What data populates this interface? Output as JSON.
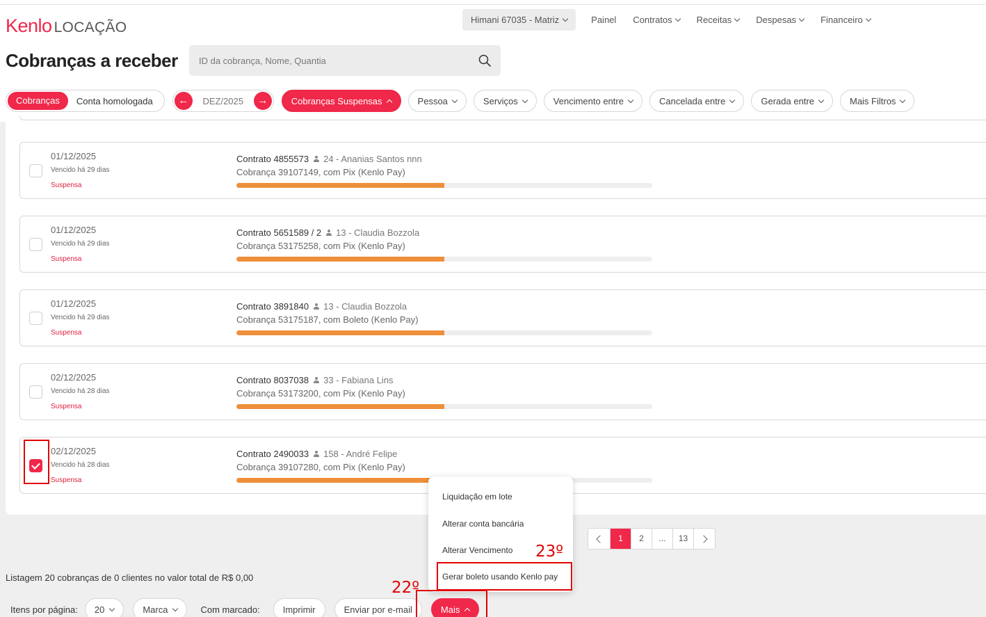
{
  "brand": {
    "name": "Kenlo",
    "product": "LOCAÇÃO"
  },
  "nav": {
    "branch": "Himani 67035 - Matriz",
    "items": [
      "Painel",
      "Contratos",
      "Receitas",
      "Despesas",
      "Financeiro"
    ]
  },
  "page": {
    "title": "Cobranças a receber"
  },
  "search": {
    "placeholder": "ID da cobrança, Nome, Quantia"
  },
  "filters": {
    "tab_active": "Cobranças",
    "tab_other": "Conta homologada",
    "month": "DEZ/2025",
    "suspended": "Cobranças Suspensas",
    "pills": [
      "Pessoa",
      "Serviços",
      "Vencimento entre",
      "Cancelada entre",
      "Gerada entre",
      "Mais Filtros"
    ]
  },
  "charges": [
    {
      "date": "01/12/2025",
      "due": "Vencido há 29 dias",
      "status": "Suspensa",
      "contract": "Contrato 4855573",
      "person": "24 - Ananias Santos nnn",
      "charge": "Cobrança 39107149, com Pix (Kenlo Pay)",
      "progress": 0.5,
      "checked": false
    },
    {
      "date": "01/12/2025",
      "due": "Vencido há 29 dias",
      "status": "Suspensa",
      "contract": "Contrato 5651589 / 2",
      "person": "13 - Claudia Bozzola",
      "charge": "Cobrança 53175258, com Pix (Kenlo Pay)",
      "progress": 0.5,
      "checked": false
    },
    {
      "date": "01/12/2025",
      "due": "Vencido há 29 dias",
      "status": "Suspensa",
      "contract": "Contrato 3891840",
      "person": "13 - Claudia Bozzola",
      "charge": "Cobrança 53175187, com Boleto (Kenlo Pay)",
      "progress": 0.5,
      "checked": false
    },
    {
      "date": "02/12/2025",
      "due": "Vencido há 28 dias",
      "status": "Suspensa",
      "contract": "Contrato 8037038",
      "person": "33 - Fabiana Lins",
      "charge": "Cobrança 53173200, com Pix (Kenlo Pay)",
      "progress": 0.5,
      "checked": false
    },
    {
      "date": "02/12/2025",
      "due": "Vencido há 28 dias",
      "status": "Suspensa",
      "contract": "Contrato 2490033",
      "person": "158 - André Felipe",
      "charge": "Cobrança 39107280, com Pix (Kenlo Pay)",
      "progress": 0.5,
      "checked": true
    }
  ],
  "menu": {
    "items": [
      "Liquidação em lote",
      "Alterar conta bancária",
      "Alterar Vencimento",
      "Gerar boleto usando Kenlo pay"
    ]
  },
  "annotations": {
    "step_menu": "23º",
    "step_more": "22º"
  },
  "pagination": {
    "pages": [
      "1",
      "2",
      "...",
      "13"
    ],
    "active": "1"
  },
  "summary": "Listagem 20 cobranças de 0 clientes no valor total de R$ 0,00",
  "bottom": {
    "per_page_label": "Itens por página:",
    "per_page_value": "20",
    "mark_label": "Marca",
    "with_marked_label": "Com marcado:",
    "print_label": "Imprimir",
    "email_label": "Enviar por e-mail",
    "more_label": "Mais"
  },
  "colors": {
    "accent": "#f0284a",
    "progress": "#ee8f3a",
    "annotation": "#e00000"
  }
}
